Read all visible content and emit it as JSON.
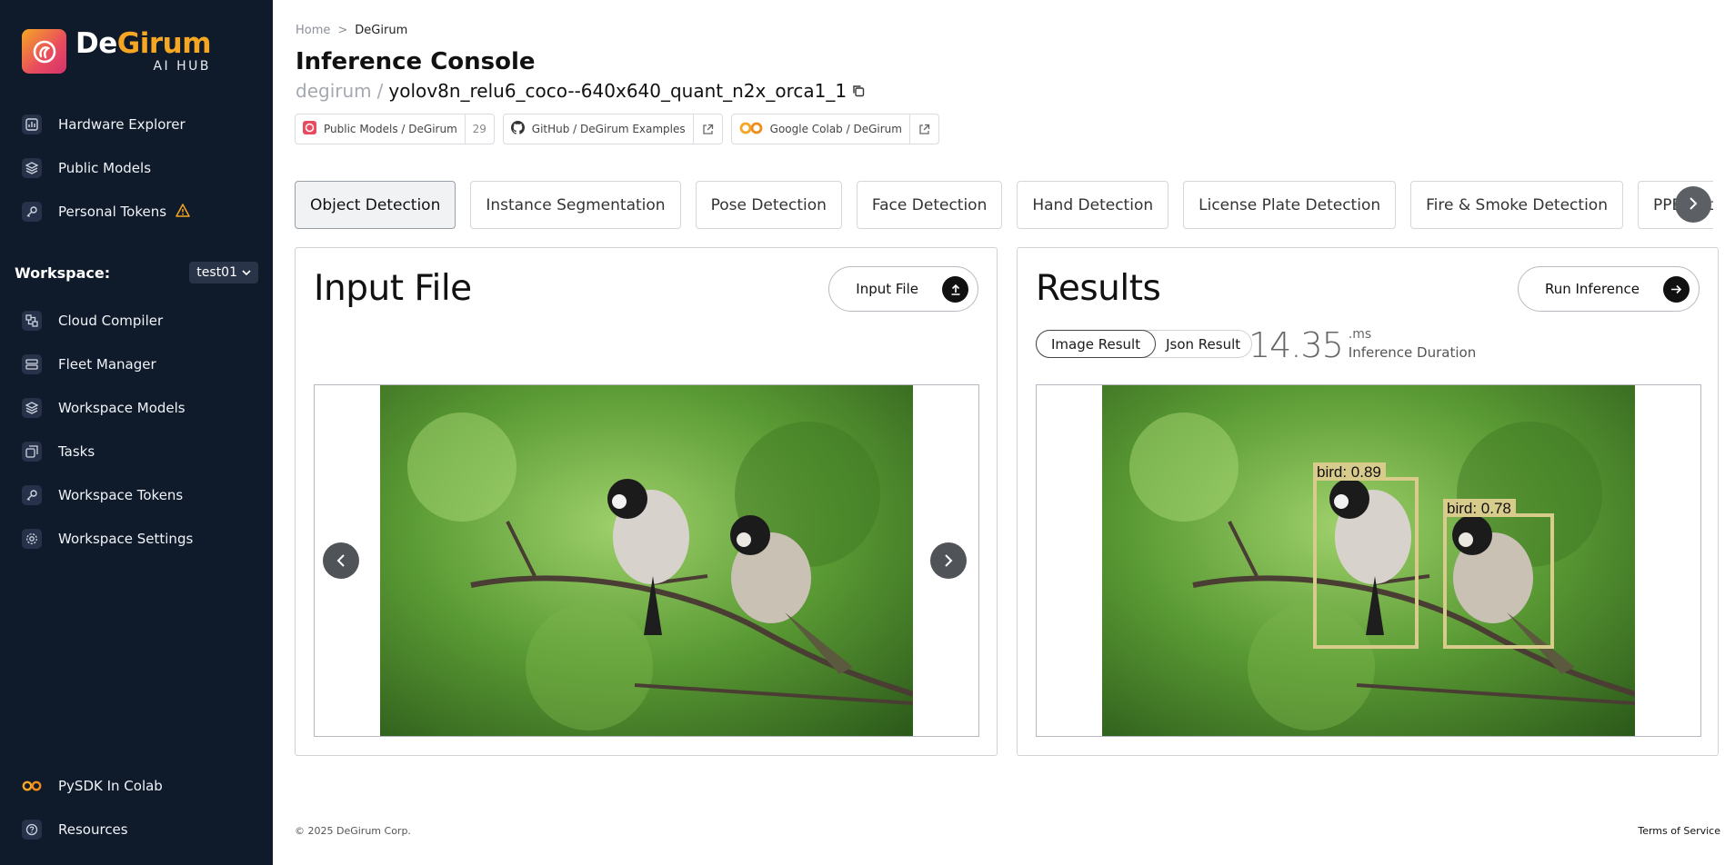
{
  "brand": {
    "name_part1": "De",
    "name_part2": "Girum",
    "subtitle": "AI HUB"
  },
  "sidebar": {
    "top_items": [
      {
        "label": "Hardware Explorer",
        "icon": "chart-icon"
      },
      {
        "label": "Public Models",
        "icon": "layers-icon"
      },
      {
        "label": "Personal Tokens",
        "icon": "key-icon",
        "warning": true
      }
    ],
    "workspace_label": "Workspace:",
    "workspace_value": "test01",
    "workspace_items": [
      {
        "label": "Cloud Compiler",
        "icon": "compiler-icon"
      },
      {
        "label": "Fleet Manager",
        "icon": "server-icon"
      },
      {
        "label": "Workspace Models",
        "icon": "layers-icon"
      },
      {
        "label": "Tasks",
        "icon": "tasks-icon"
      },
      {
        "label": "Workspace Tokens",
        "icon": "key-icon"
      },
      {
        "label": "Workspace Settings",
        "icon": "gear-icon"
      }
    ],
    "bottom_items": [
      {
        "label": "PySDK In Colab",
        "icon": "colab-icon"
      },
      {
        "label": "Resources",
        "icon": "help-icon"
      }
    ]
  },
  "breadcrumb": {
    "home": "Home",
    "separator": ">",
    "current": "DeGirum"
  },
  "page": {
    "title": "Inference Console",
    "model_owner": "degirum",
    "model_sep": "/",
    "model_name": "yolov8n_relu6_coco--640x640_quant_n2x_orca1_1"
  },
  "links": [
    {
      "label": "Public Models / DeGirum",
      "count": "29",
      "icon": "degirum-logo-icon"
    },
    {
      "label": "GitHub / DeGirum Examples",
      "icon": "github-icon"
    },
    {
      "label": "Google Colab / DeGirum",
      "icon": "colab-icon"
    }
  ],
  "tabs": [
    {
      "label": "Object Detection",
      "active": true
    },
    {
      "label": "Instance Segmentation"
    },
    {
      "label": "Pose Detection"
    },
    {
      "label": "Face Detection"
    },
    {
      "label": "Hand Detection"
    },
    {
      "label": "License Plate Detection"
    },
    {
      "label": "Fire & Smoke Detection"
    },
    {
      "label": "PPE Detection"
    }
  ],
  "input_panel": {
    "title": "Input File",
    "button_label": "Input File"
  },
  "results_panel": {
    "title": "Results",
    "button_label": "Run Inference",
    "toggle": [
      "Image Result",
      "Json Result"
    ],
    "toggle_active": "Image Result",
    "duration_value": "14.35",
    "duration_unit": ".ms",
    "duration_label": "Inference Duration",
    "detections": [
      {
        "label": "bird: 0.89"
      },
      {
        "label": "bird: 0.78"
      }
    ]
  },
  "footer": {
    "copyright": "© 2025 DeGirum Corp.",
    "terms": "Terms of Service"
  },
  "colors": {
    "sidebar_bg": "#0f1a2b",
    "brand_accent": "#f5a623",
    "bbox": "#d8cc8c"
  }
}
